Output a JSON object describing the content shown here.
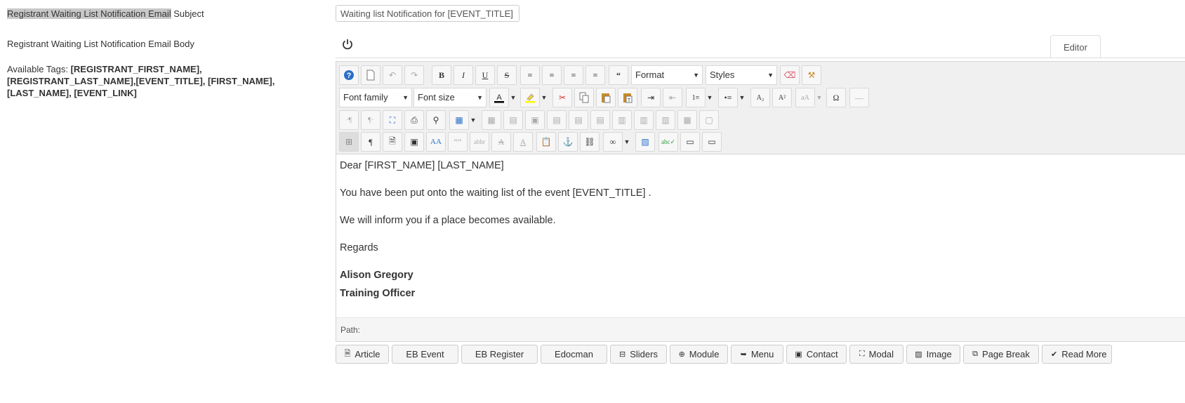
{
  "form": {
    "subject_label_highlight": "Registrant Waiting List Notification Email",
    "subject_label_rest": " Subject",
    "subject_value": "Waiting list Notification for [EVENT_TITLE]",
    "body_label": "Registrant Waiting List Notification Email Body",
    "tags_prefix": "Available Tags: ",
    "tags_line1": "[REGISTRANT_FIRST_NAME],",
    "tags_line2": "[REGISTRANT_LAST_NAME],[EVENT_TITLE], [FIRST_NAME],",
    "tags_line3": "[LAST_NAME], [EVENT_LINK]"
  },
  "editor": {
    "tab_label": "Editor",
    "format_select": "Format",
    "styles_select": "Styles",
    "font_family_select": "Font family",
    "font_size_select": "Font size",
    "path_label": "Path:"
  },
  "content": {
    "p1": "Dear [FIRST_NAME] [LAST_NAME]",
    "p2": "You have been put onto the waiting list of the event [EVENT_TITLE] .",
    "p3": "We will inform you if a place becomes available.",
    "p4": "Regards",
    "signature_name": "Alison Gregory",
    "signature_title": "Training Officer"
  },
  "extensions": {
    "article": "Article",
    "eb_event": "EB Event",
    "eb_register": "EB Register",
    "edocman": "Edocman",
    "sliders": "Sliders",
    "module": "Module",
    "menu": "Menu",
    "contact": "Contact",
    "modal": "Modal",
    "image": "Image",
    "page_break": "Page Break",
    "read_more": "Read More"
  },
  "colors": {
    "highlight": "#c8c8c8",
    "help_icon": "#2a6fc9",
    "cut_icon": "#d9342b",
    "pencil_icon": "#e8a33c"
  }
}
